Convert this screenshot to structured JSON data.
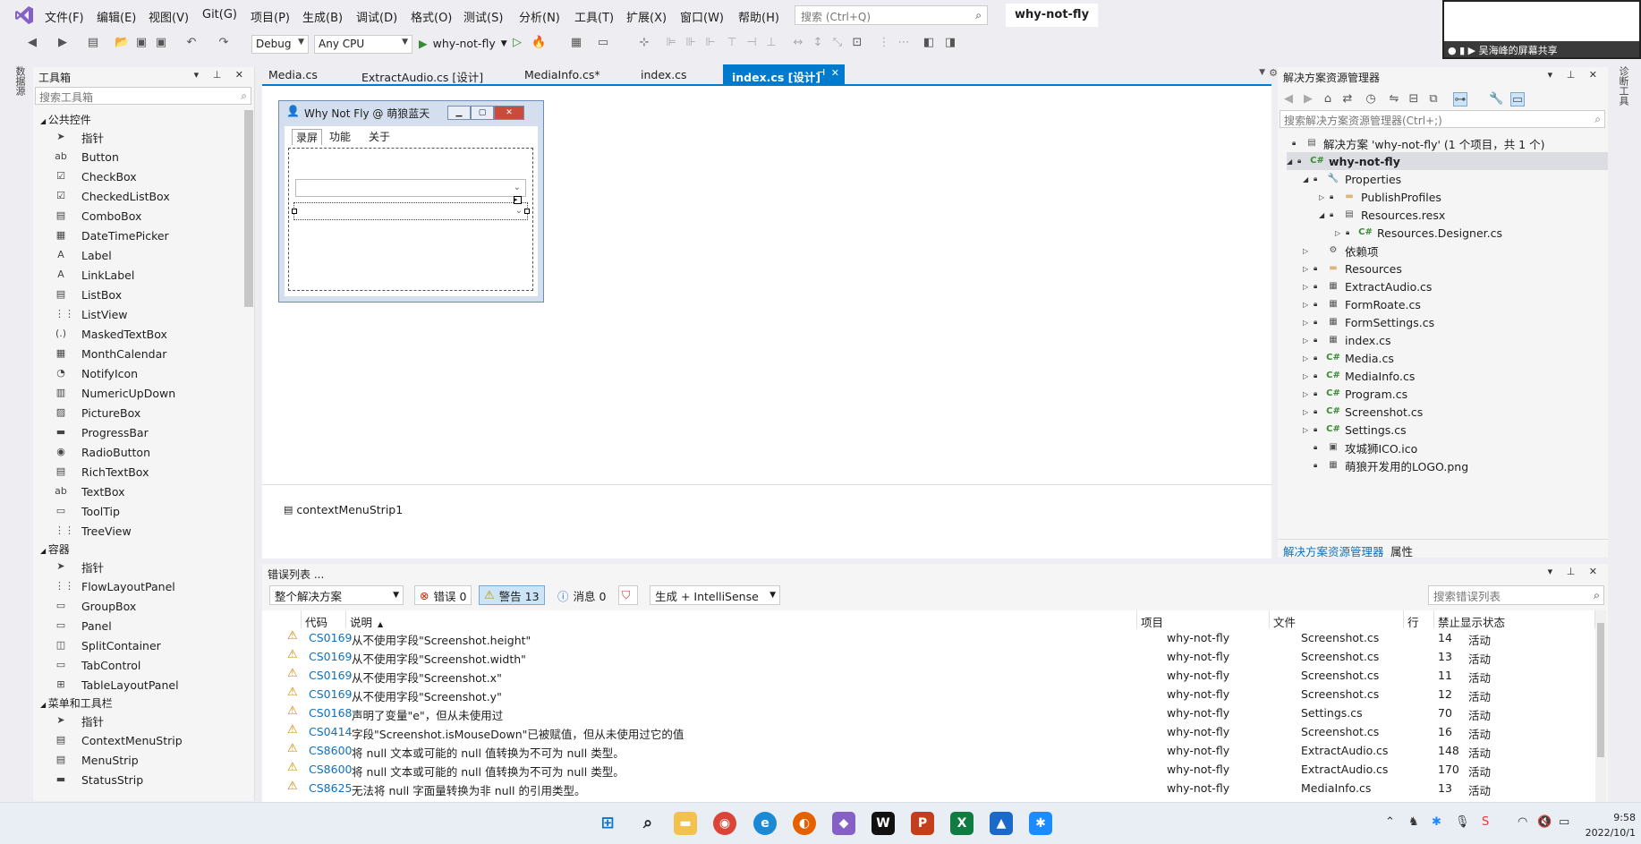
{
  "menu": {
    "items": [
      "文件(F)",
      "编辑(E)",
      "视图(V)",
      "Git(G)",
      "项目(P)",
      "生成(B)",
      "调试(D)",
      "格式(O)",
      "测试(S)",
      "分析(N)",
      "工具(T)",
      "扩展(X)",
      "窗口(W)",
      "帮助(H)"
    ],
    "search_placeholder": "搜索 (Ctrl+Q)",
    "solution_name": "why-not-fly"
  },
  "toolbar": {
    "config": "Debug",
    "platform": "Any CPU",
    "run_target": "why-not-fly"
  },
  "toolbox": {
    "title": "工具箱",
    "search_placeholder": "搜索工具箱",
    "group_common": "公共控件",
    "common_items": [
      "指针",
      "Button",
      "CheckBox",
      "CheckedListBox",
      "ComboBox",
      "DateTimePicker",
      "Label",
      "LinkLabel",
      "ListBox",
      "ListView",
      "MaskedTextBox",
      "MonthCalendar",
      "NotifyIcon",
      "NumericUpDown",
      "PictureBox",
      "ProgressBar",
      "RadioButton",
      "RichTextBox",
      "TextBox",
      "ToolTip",
      "TreeView"
    ],
    "group_containers": "容器",
    "container_items": [
      "指针",
      "FlowLayoutPanel",
      "GroupBox",
      "Panel",
      "SplitContainer",
      "TabControl",
      "TableLayoutPanel"
    ],
    "group_menus": "菜单和工具栏",
    "menu_items": [
      "指针",
      "ContextMenuStrip",
      "MenuStrip",
      "StatusStrip"
    ]
  },
  "left_strip": {
    "label": "数据源"
  },
  "right_strip": {
    "label": "诊断工具"
  },
  "doc_tabs": [
    "Media.cs",
    "ExtractAudio.cs [设计]",
    "MediaInfo.cs*",
    "index.cs",
    "index.cs [设计]"
  ],
  "form": {
    "title": "Why Not Fly @ 萌狼蓝天",
    "tabs": [
      "录屏",
      "功能",
      "关于"
    ]
  },
  "tray": {
    "component": "contextMenuStrip1"
  },
  "solution_explorer": {
    "title": "解决方案资源管理器",
    "search_placeholder": "搜索解决方案资源管理器(Ctrl+;)",
    "solution_label": "解决方案 'why-not-fly' (1 个项目，共 1 个)",
    "project": "why-not-fly",
    "nodes": [
      "Properties",
      "PublishProfiles",
      "Resources.resx",
      "Resources.Designer.cs",
      "依赖项",
      "Resources",
      "ExtractAudio.cs",
      "FormRoate.cs",
      "FormSettings.cs",
      "index.cs",
      "Media.cs",
      "MediaInfo.cs",
      "Program.cs",
      "Screenshot.cs",
      "Settings.cs",
      "攻城狮ICO.ico",
      "萌狼开发用的LOGO.png"
    ],
    "tabs": [
      "解决方案资源管理器",
      "属性"
    ]
  },
  "error_list": {
    "title": "错误列表 ...",
    "scope": "整个解决方案",
    "errors_label": "错误 0",
    "warnings_label": "警告 13",
    "messages_label": "消息 0",
    "build_filter": "生成 + IntelliSense",
    "search_placeholder": "搜索错误列表",
    "columns": [
      "代码",
      "说明",
      "项目",
      "文件",
      "行",
      "禁止显示状态"
    ],
    "rows": [
      {
        "code": "CS0169",
        "desc": "从不使用字段\"Screenshot.height\"",
        "project": "why-not-fly",
        "file": "Screenshot.cs",
        "line": "14",
        "state": "活动"
      },
      {
        "code": "CS0169",
        "desc": "从不使用字段\"Screenshot.width\"",
        "project": "why-not-fly",
        "file": "Screenshot.cs",
        "line": "13",
        "state": "活动"
      },
      {
        "code": "CS0169",
        "desc": "从不使用字段\"Screenshot.x\"",
        "project": "why-not-fly",
        "file": "Screenshot.cs",
        "line": "11",
        "state": "活动"
      },
      {
        "code": "CS0169",
        "desc": "从不使用字段\"Screenshot.y\"",
        "project": "why-not-fly",
        "file": "Screenshot.cs",
        "line": "12",
        "state": "活动"
      },
      {
        "code": "CS0168",
        "desc": "声明了变量\"e\"，但从未使用过",
        "project": "why-not-fly",
        "file": "Settings.cs",
        "line": "70",
        "state": "活动"
      },
      {
        "code": "CS0414",
        "desc": "字段\"Screenshot.isMouseDown\"已被赋值，但从未使用过它的值",
        "project": "why-not-fly",
        "file": "Screenshot.cs",
        "line": "16",
        "state": "活动"
      },
      {
        "code": "CS8600",
        "desc": "将 null 文本或可能的 null 值转换为不可为 null 类型。",
        "project": "why-not-fly",
        "file": "ExtractAudio.cs",
        "line": "148",
        "state": "活动"
      },
      {
        "code": "CS8600",
        "desc": "将 null 文本或可能的 null 值转换为不可为 null 类型。",
        "project": "why-not-fly",
        "file": "ExtractAudio.cs",
        "line": "170",
        "state": "活动"
      },
      {
        "code": "CS8625",
        "desc": "无法将 null 字面量转换为非 null 的引用类型。",
        "project": "why-not-fly",
        "file": "MediaInfo.cs",
        "line": "13",
        "state": "活动"
      }
    ]
  },
  "share": {
    "label": "吴海峰的屏幕共享"
  },
  "clock": {
    "time": "9:58",
    "date": "2022/10/1"
  }
}
